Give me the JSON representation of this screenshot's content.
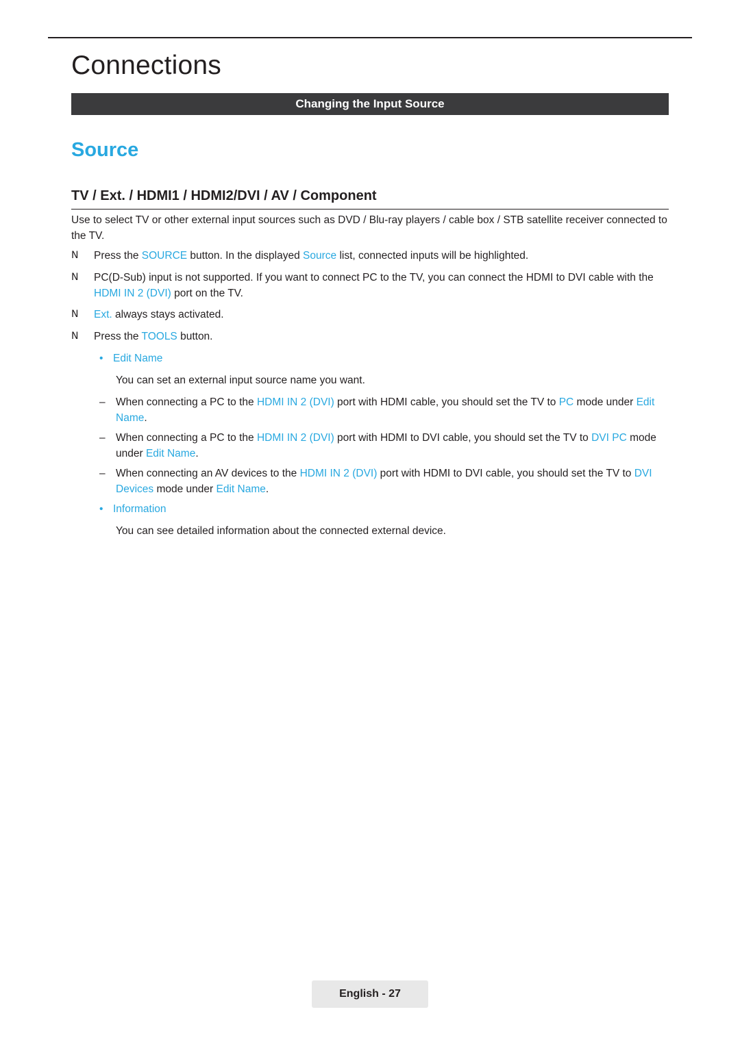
{
  "page": {
    "chapter_title": "Connections",
    "section_bar_label": "Changing the Input Source",
    "heading_blue": "Source",
    "heading_sub": "TV / Ext. / HDMI1 / HDMI2/DVI / AV / Component",
    "intro": "Use to select TV or other external input sources such as DVD / Blu-ray players / cable box / STB satellite receiver connected to the TV.",
    "bullet_marker": "N",
    "dash_marker": "–",
    "dot_marker": "•",
    "items": [
      {
        "parts": [
          {
            "text": "Press the ",
            "color": "black"
          },
          {
            "text": "SOURCE",
            "color": "blue"
          },
          {
            "text": " button. In the displayed ",
            "color": "black"
          },
          {
            "text": "Source",
            "color": "blue"
          },
          {
            "text": " list, connected inputs will be highlighted.",
            "color": "black"
          }
        ]
      },
      {
        "parts": [
          {
            "text": "PC(D-Sub) input is not supported. If you want to connect PC to the TV, you can connect the HDMI to DVI cable with the ",
            "color": "black"
          },
          {
            "text": "HDMI IN 2 (DVI)",
            "color": "blue"
          },
          {
            "text": " port on the TV.",
            "color": "black"
          }
        ]
      },
      {
        "parts": [
          {
            "text": "Ext.",
            "color": "blue"
          },
          {
            "text": " always stays activated.",
            "color": "black"
          }
        ]
      },
      {
        "parts": [
          {
            "text": "Press the ",
            "color": "black"
          },
          {
            "text": "TOOLS",
            "color": "blue"
          },
          {
            "text": " button.",
            "color": "black"
          }
        ]
      }
    ],
    "sub_items": {
      "edit_name_label": "Edit Name",
      "edit_name_desc": "You can set an external input source name you want.",
      "information_label": "Information",
      "information_desc": "You can see detailed information about the connected external device."
    },
    "dashes": [
      [
        {
          "text": "When connecting a PC to the ",
          "color": "black"
        },
        {
          "text": "HDMI IN 2 (DVI)",
          "color": "blue"
        },
        {
          "text": " port with HDMI cable, you should set the TV to ",
          "color": "black"
        },
        {
          "text": "PC",
          "color": "blue"
        },
        {
          "text": " mode under ",
          "color": "black"
        },
        {
          "text": "Edit Name",
          "color": "blue"
        },
        {
          "text": ".",
          "color": "black"
        }
      ],
      [
        {
          "text": "When connecting a PC to the ",
          "color": "black"
        },
        {
          "text": "HDMI IN 2 (DVI)",
          "color": "blue"
        },
        {
          "text": " port with HDMI to DVI cable, you should set the TV to ",
          "color": "black"
        },
        {
          "text": "DVI PC",
          "color": "blue"
        },
        {
          "text": " mode under ",
          "color": "black"
        },
        {
          "text": "Edit Name",
          "color": "blue"
        },
        {
          "text": ".",
          "color": "black"
        }
      ],
      [
        {
          "text": "When connecting an AV devices to the ",
          "color": "black"
        },
        {
          "text": "HDMI IN 2 (DVI)",
          "color": "blue"
        },
        {
          "text": " port with HDMI to DVI cable, you should set the TV to ",
          "color": "black"
        },
        {
          "text": "DVI Devices",
          "color": "blue"
        },
        {
          "text": " mode under ",
          "color": "black"
        },
        {
          "text": "Edit Name",
          "color": "blue"
        },
        {
          "text": ".",
          "color": "black"
        }
      ]
    ],
    "footer": "English - 27",
    "colors": {
      "accent": "#28a8e0",
      "bar": "#3b3b3d",
      "text": "#231f20",
      "footer_bg": "#e8e8e8"
    }
  }
}
